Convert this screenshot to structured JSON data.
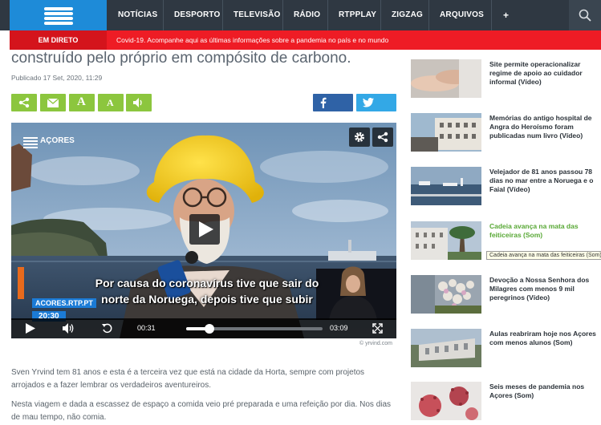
{
  "nav": {
    "items": [
      "NOTÍCIAS",
      "DESPORTO",
      "TELEVISÃO",
      "RÁDIO",
      "RTPPLAY",
      "ZIGZAG",
      "ARQUIVOS",
      "+"
    ]
  },
  "live": {
    "label": "EM DIRETO",
    "headline": "Covid-19. Acompanhe aqui as últimas informações sobre a pandemia no país e no mundo"
  },
  "article": {
    "title": "construído pelo próprio em compósito de carbono.",
    "published": "Publicado 17 Set, 2020, 11:29",
    "font_buttons": [
      "A",
      "A"
    ],
    "paragraphs": [
      "Sven Yrvind tem 81 anos e esta é a terceira vez que está na cidade da Horta, sempre com projetos arrojados e a fazer lembrar os verdadeiros aventureiros.",
      "Nesta viagem e dada a escassez de espaço a comida veio pré preparada e uma refeição por dia. Nos dias de mau tempo, não comia."
    ]
  },
  "video": {
    "channel": "AÇORES",
    "subtitle_line1": "Por causa do coronavírus tive que sair do",
    "subtitle_line2": "norte da Noruega, depois tive que subir",
    "badge": "ACORES.RTP.PT",
    "badge_time": "20:30",
    "current_time": "00:31",
    "duration": "03:09",
    "progress": 0.17,
    "copyright": "© yrvind.com"
  },
  "sidebar": {
    "items": [
      {
        "title": "Site permite operacionalizar regime de apoio ao cuidador informal (Vídeo)"
      },
      {
        "title": "Memórias do antigo hospital de Angra do Heroísmo foram publicadas num livro (Vídeo)"
      },
      {
        "title": "Velejador de 81 anos passou 78 dias no mar entre a Noruega e o Faial (Vídeo)"
      },
      {
        "title": "Cadeia avança na mata das feiticeiras (Som)"
      },
      {
        "title": "Devoção a Nossa Senhora dos Milagres com menos 9 mil peregrinos (Vídeo)"
      },
      {
        "title": "Aulas reabriram hoje nos Açores com menos alunos (Som)"
      },
      {
        "title": "Seis meses de pandemia nos Açores (Som)"
      }
    ],
    "tooltip": "Cadeia avança na mata das feiticeiras (Som)"
  },
  "colors": {
    "nav_bg": "#2f3842",
    "logo_blue": "#1e8bd8",
    "live_red": "#ee1c25",
    "share_green": "#8cc63e",
    "facebook": "#2f62a6",
    "twitter": "#33a8e6"
  }
}
